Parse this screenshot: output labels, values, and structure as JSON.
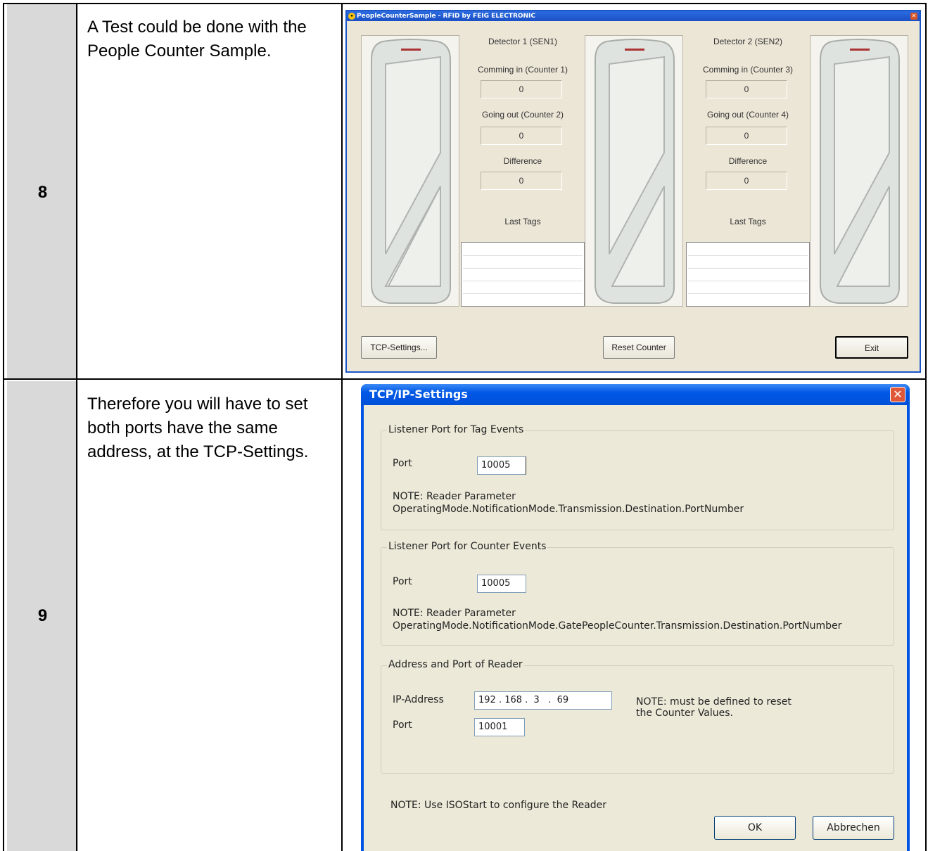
{
  "rows": [
    {
      "number": "8",
      "text": "A Test could be done with the People Counter Sample."
    },
    {
      "number": "9",
      "text": "Therefore you will have to set both ports have the same address, at the TCP-Settings."
    }
  ],
  "people_counter": {
    "app_icon": "feig-icon",
    "title": "PeopleCounterSample - RFID by FEIG ELECTRONIC",
    "detectors": [
      {
        "name": "Detector 1 (SEN1)",
        "in_label": "Comming in (Counter 1)",
        "in_value": "0",
        "out_label": "Going out (Counter 2)",
        "out_value": "0",
        "diff_label": "Difference",
        "diff_value": "0",
        "tags_label": "Last Tags"
      },
      {
        "name": "Detector 2 (SEN2)",
        "in_label": "Comming in (Counter 3)",
        "in_value": "0",
        "out_label": "Going out (Counter 4)",
        "out_value": "0",
        "diff_label": "Difference",
        "diff_value": "0",
        "tags_label": "Last Tags"
      }
    ],
    "buttons": {
      "tcp": "TCP-Settings...",
      "reset": "Reset Counter",
      "exit": "Exit"
    }
  },
  "tcp_settings": {
    "title": "TCP/IP-Settings",
    "close_glyph": "✕",
    "tag_group": {
      "legend": "Listener Port for Tag Events",
      "port_label": "Port",
      "port_value": "10005",
      "note_line1": "NOTE: Reader Parameter",
      "note_line2": "OperatingMode.NotificationMode.Transmission.Destination.PortNumber"
    },
    "counter_group": {
      "legend": "Listener Port for Counter Events",
      "port_label": "Port",
      "port_value": "10005",
      "note_line1": "NOTE: Reader Parameter",
      "note_line2": "OperatingMode.NotificationMode.GatePeopleCounter.Transmission.Destination.PortNumber"
    },
    "reader_group": {
      "legend": "Address and Port of Reader",
      "ip_label": "IP-Address",
      "ip_value": "192 . 168 .  3   .  69",
      "port_label": "Port",
      "port_value": "10001",
      "note_line1": "NOTE: must be defined to reset",
      "note_line2": "the Counter Values."
    },
    "bottom_note": "NOTE: Use ISOStart to configure the Reader",
    "ok": "OK",
    "cancel": "Abbrechen"
  }
}
